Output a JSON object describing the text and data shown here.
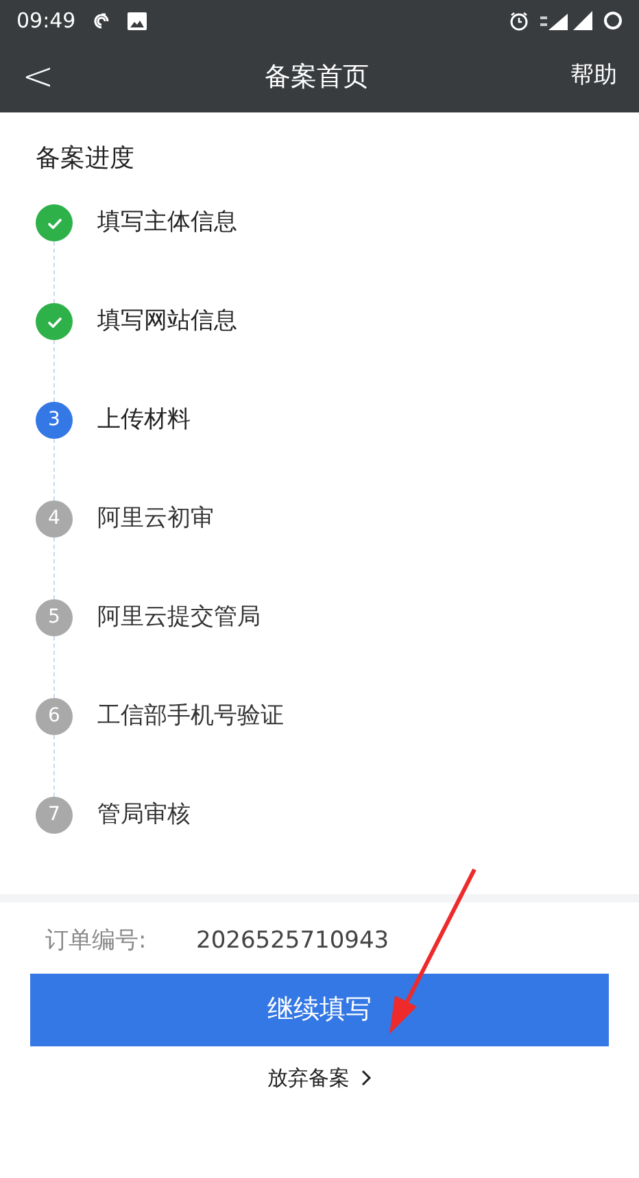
{
  "status_bar": {
    "time": "09:49"
  },
  "header": {
    "back": "<",
    "title": "备案首页",
    "action": "帮助"
  },
  "progress": {
    "title": "备案进度",
    "steps": [
      {
        "label": "填写主体信息",
        "done": true
      },
      {
        "label": "填写网站信息",
        "done": true
      },
      {
        "number": "3",
        "label": "上传材料",
        "done": false,
        "current": true
      },
      {
        "number": "4",
        "label": "阿里云初审",
        "done": false,
        "current": false
      },
      {
        "number": "5",
        "label": "阿里云提交管局",
        "done": false,
        "current": false
      },
      {
        "number": "6",
        "label": "工信部手机号验证",
        "done": false,
        "current": false
      },
      {
        "number": "7",
        "label": "管局审核",
        "done": false,
        "current": false
      }
    ]
  },
  "order": {
    "rows": [
      {
        "label": "订单编号:",
        "value": "2026525710943"
      }
    ]
  },
  "primary_button": "继续填写",
  "secondary_link": "放弃备案"
}
